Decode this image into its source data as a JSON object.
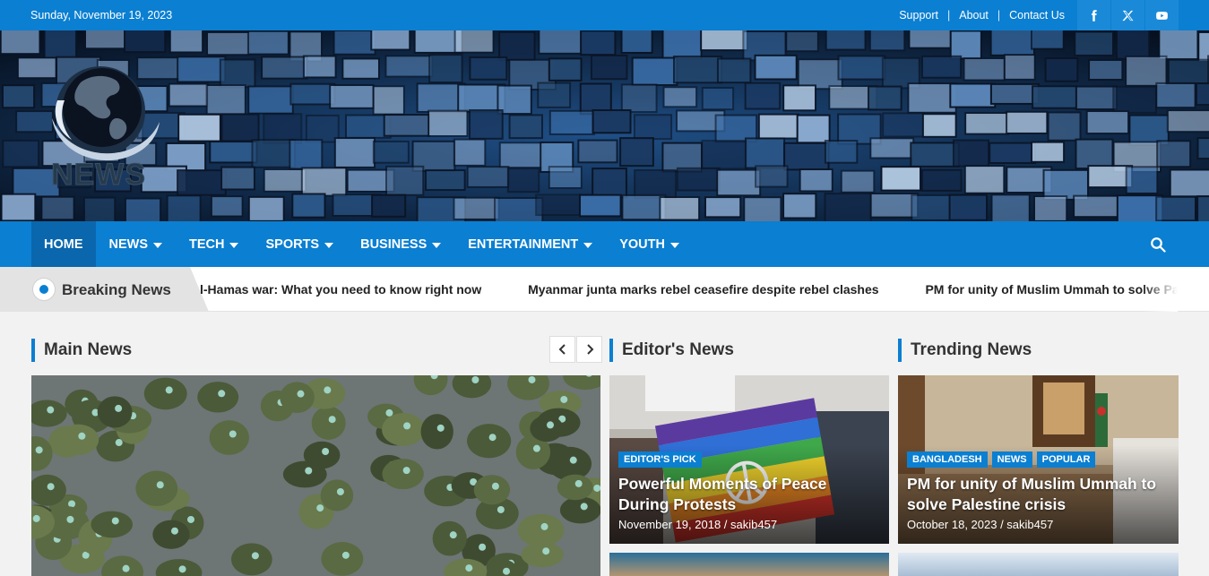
{
  "topbar": {
    "date": "Sunday, November 19, 2023",
    "links": [
      "Support",
      "About",
      "Contact Us"
    ],
    "separator": "|",
    "social": [
      "facebook-icon",
      "x-twitter-icon",
      "youtube-icon"
    ]
  },
  "brand": {
    "logo_text": "NEWS"
  },
  "nav": {
    "items": [
      {
        "label": "HOME",
        "active": true,
        "dropdown": false
      },
      {
        "label": "NEWS",
        "dropdown": true
      },
      {
        "label": "TECH",
        "dropdown": true
      },
      {
        "label": "SPORTS",
        "dropdown": true
      },
      {
        "label": "BUSINESS",
        "dropdown": true
      },
      {
        "label": "ENTERTAINMENT",
        "dropdown": true
      },
      {
        "label": "YOUTH",
        "dropdown": true
      }
    ],
    "search_icon": "search-icon"
  },
  "breaking": {
    "label": "Breaking News",
    "items": [
      "l-Hamas war: What you need to know right now",
      "Myanmar junta marks rebel ceasefire despite rebel clashes",
      "PM for unity of Muslim Ummah to solve Palestine crisis"
    ]
  },
  "sections": {
    "main": "Main News",
    "editors": "Editor's News",
    "trending": "Trending News"
  },
  "editors_card": {
    "tags": [
      "EDITOR'S PICK"
    ],
    "title": "Powerful Moments of Peace During Protests",
    "meta": "November 19, 2018 / sakib457"
  },
  "trending_card": {
    "tags": [
      "BANGLADESH",
      "NEWS",
      "POPULAR"
    ],
    "title": "PM for unity of Muslim Ummah to solve Palestine crisis",
    "meta": "October 18, 2023 / sakib457"
  },
  "colors": {
    "accent": "#0b7fd1",
    "accent_dark": "#0a67ad"
  }
}
